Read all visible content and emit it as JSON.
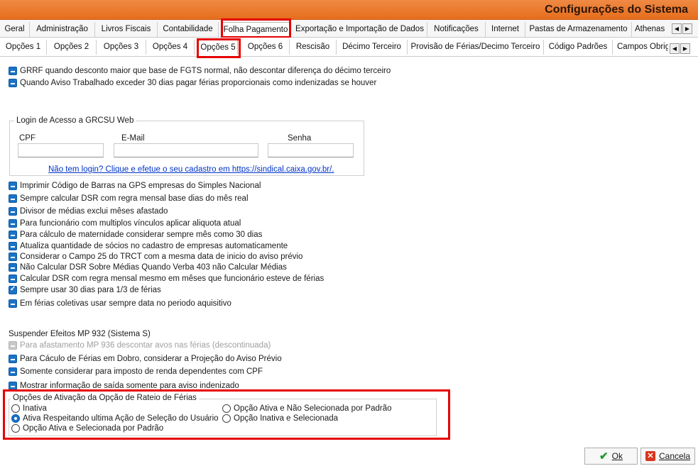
{
  "window": {
    "title": "Configurações do Sistema"
  },
  "main_tabs": [
    "Geral",
    "Administração",
    "Livros Fiscais",
    "Contabilidade",
    "Folha Pagamento",
    "Exportação e Importação de Dados",
    "Notificações",
    "Internet",
    "Pastas de Armazenamento",
    "Athenas"
  ],
  "sub_tabs": [
    "Opções 1",
    "Opções 2",
    "Opções 3",
    "Opções 4",
    "Opções 5",
    "Opções 6",
    "Rescisão",
    "Décimo Terceiro",
    "Provisão de Férias/Decimo Terceiro",
    "Código Padrões",
    "Campos Obrig"
  ],
  "top_options": [
    {
      "label": "GRRF quando desconto maior que base de FGTS normal, não descontar diferença do décimo terceiro",
      "state": "indeterminate"
    },
    {
      "label": "Quando Aviso Trabalhado exceder 30 dias pagar férias  proporcionais como indenizadas se houver",
      "state": "indeterminate"
    }
  ],
  "login_group": {
    "title": "Login de Acesso a GRCSU Web",
    "cpf_label": "CPF",
    "email_label": "E-Mail",
    "password_label": "Senha",
    "cpf_value": "",
    "email_value": "",
    "password_value": "",
    "register_link": "Não tem login? Clique e efetue o seu cadastro em https://sindical.caixa.gov.br/."
  },
  "options": [
    {
      "label": "Imprimir Código de Barras na GPS empresas do Simples Nacional",
      "state": "indeterminate"
    },
    {
      "label": "Sempre calcular DSR com regra mensal base dias do mês real",
      "state": "indeterminate"
    },
    {
      "label": "Divisor de médias exclui mêses afastado",
      "state": "indeterminate"
    },
    {
      "label": "Para funcionário com multiplos vínculos aplicar aliquota atual",
      "state": "indeterminate"
    },
    {
      "label": "Para cálculo de maternidade considerar sempre mês como 30 dias",
      "state": "indeterminate"
    },
    {
      "label": "Atualiza quantidade de sócios no cadastro de empresas automaticamente",
      "state": "indeterminate"
    },
    {
      "label": "Considerar o Campo 25 do TRCT com a mesma data de inicio do aviso prévio",
      "state": "indeterminate"
    },
    {
      "label": "Não Calcular DSR Sobre Médias Quando Verba 403 não Calcular Médias",
      "state": "indeterminate"
    },
    {
      "label": "Calcular DSR com regra mensal mesmo em mêses que funcionário esteve de férias",
      "state": "indeterminate"
    },
    {
      "label": "Sempre usar 30 dias para 1/3 de férias",
      "state": "checked"
    },
    {
      "label": "Em férias coletivas usar sempre data  no periodo aquisitivo",
      "state": "indeterminate"
    }
  ],
  "mp932": {
    "heading": "Suspender Efeitos MP 932 (Sistema S)",
    "disabled_option": "Para afastamento MP 936 descontar avos nas férias (descontinuada)"
  },
  "lower_options": [
    {
      "label": "Para Cáculo de Férias em Dobro, considerar a Projeção do  Aviso Prévio",
      "state": "indeterminate"
    },
    {
      "label": "Somente considerar para imposto de renda dependentes com CPF",
      "state": "indeterminate"
    },
    {
      "label": "Mostrar informação de saída somente para aviso indenizado",
      "state": "indeterminate"
    }
  ],
  "rateio_group": {
    "title": "Opções de Ativação da Opção de Rateio de Férias",
    "options": [
      "Inativa",
      "Ativa Respeitando ultima Ação de Seleção do Usuário",
      "Opção Ativa e Selecionada por Padrão",
      "Opção Ativa e Não Selecionada por Padrão",
      "Opção Inativa e Selecionada"
    ],
    "selected": "Ativa Respeitando ultima Ação de Seleção do Usuário"
  },
  "buttons": {
    "ok": "Ok",
    "cancel": "Cancela"
  },
  "colors": {
    "titlebar": "#e56d1d",
    "highlight": "#e60000",
    "checkbox": "#1a73c7",
    "link": "#0033cc"
  },
  "icons": {
    "ok": "check-icon",
    "cancel": "x-icon",
    "scroll_left": "arrow-left-icon",
    "scroll_right": "arrow-right-icon"
  }
}
